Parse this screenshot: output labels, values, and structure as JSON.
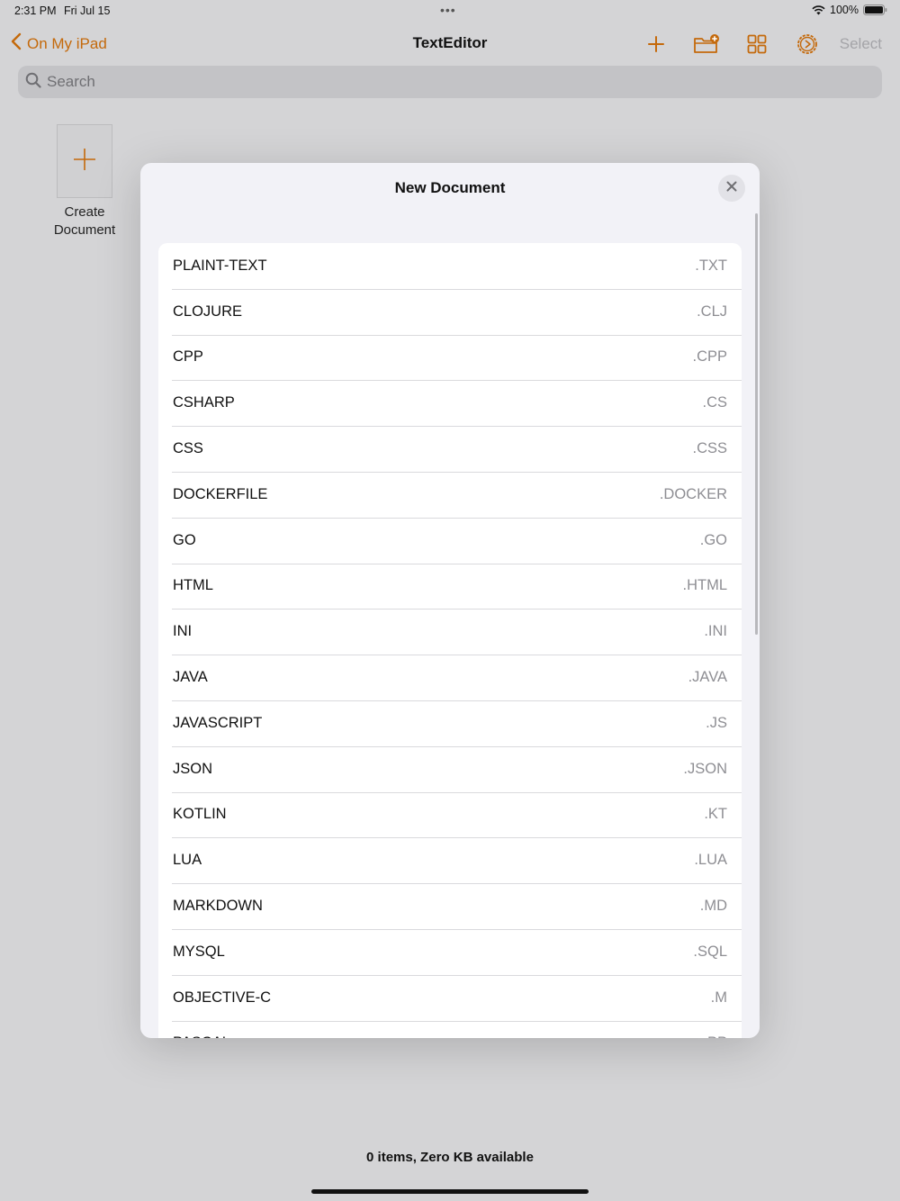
{
  "status": {
    "time": "2:31 PM",
    "date": "Fri Jul 15",
    "battery": "100%"
  },
  "nav": {
    "back_label": "On My iPad",
    "title": "TextEditor",
    "select_label": "Select"
  },
  "search": {
    "placeholder": "Search"
  },
  "create": {
    "label_line1": "Create",
    "label_line2": "Document"
  },
  "modal": {
    "title": "New Document",
    "items": [
      {
        "name": "PLAINT-TEXT",
        "ext": ".TXT"
      },
      {
        "name": "CLOJURE",
        "ext": ".CLJ"
      },
      {
        "name": "CPP",
        "ext": ".CPP"
      },
      {
        "name": "CSHARP",
        "ext": ".CS"
      },
      {
        "name": "CSS",
        "ext": ".CSS"
      },
      {
        "name": "DOCKERFILE",
        "ext": ".DOCKER"
      },
      {
        "name": "GO",
        "ext": ".GO"
      },
      {
        "name": "HTML",
        "ext": ".HTML"
      },
      {
        "name": "INI",
        "ext": ".INI"
      },
      {
        "name": "JAVA",
        "ext": ".JAVA"
      },
      {
        "name": "JAVASCRIPT",
        "ext": ".JS"
      },
      {
        "name": "JSON",
        "ext": ".JSON"
      },
      {
        "name": "KOTLIN",
        "ext": ".KT"
      },
      {
        "name": "LUA",
        "ext": ".LUA"
      },
      {
        "name": "MARKDOWN",
        "ext": ".MD"
      },
      {
        "name": "MYSQL",
        "ext": ".SQL"
      },
      {
        "name": "OBJECTIVE-C",
        "ext": ".M"
      },
      {
        "name": "PASCAL",
        "ext": ".PP"
      }
    ]
  },
  "footer": {
    "text": "0 items, Zero KB available"
  },
  "colors": {
    "accent": "#c4690b",
    "background": "#d4d4d6",
    "modal_background": "#f2f2f7"
  }
}
